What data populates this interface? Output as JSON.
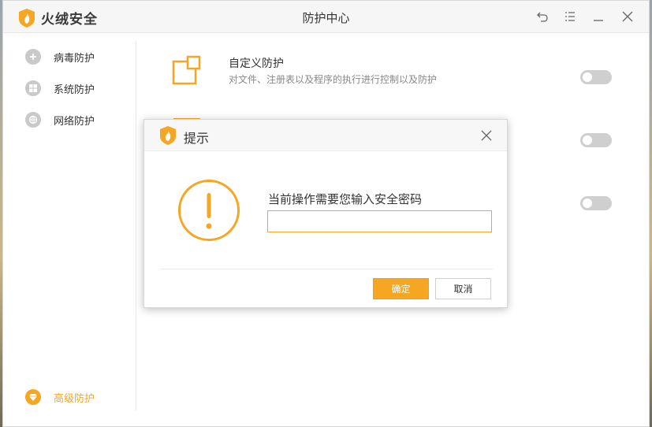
{
  "app": {
    "name": "火绒安全",
    "window_title": "防护中心"
  },
  "sidebar": {
    "items": [
      {
        "label": "病毒防护",
        "icon": "plus-circle-icon"
      },
      {
        "label": "系统防护",
        "icon": "windows-icon"
      },
      {
        "label": "网络防护",
        "icon": "globe-icon"
      }
    ],
    "bottom_item": {
      "label": "高级防护",
      "icon": "diamond-icon",
      "active": true
    }
  },
  "features": [
    {
      "title": "自定义防护",
      "desc": "对文件、注册表以及程序的执行进行控制以及防护",
      "enabled": false
    },
    {
      "title": "",
      "desc": "",
      "enabled": false
    },
    {
      "title": "",
      "desc": "",
      "enabled": false
    }
  ],
  "dialog": {
    "title": "提示",
    "message": "当前操作需要您输入安全密码",
    "password_value": "",
    "ok_label": "确定",
    "cancel_label": "取消"
  },
  "colors": {
    "accent": "#f5a623",
    "toggle_off": "#cfcfcf",
    "nav_icon_inactive": "#c9c9c9"
  }
}
